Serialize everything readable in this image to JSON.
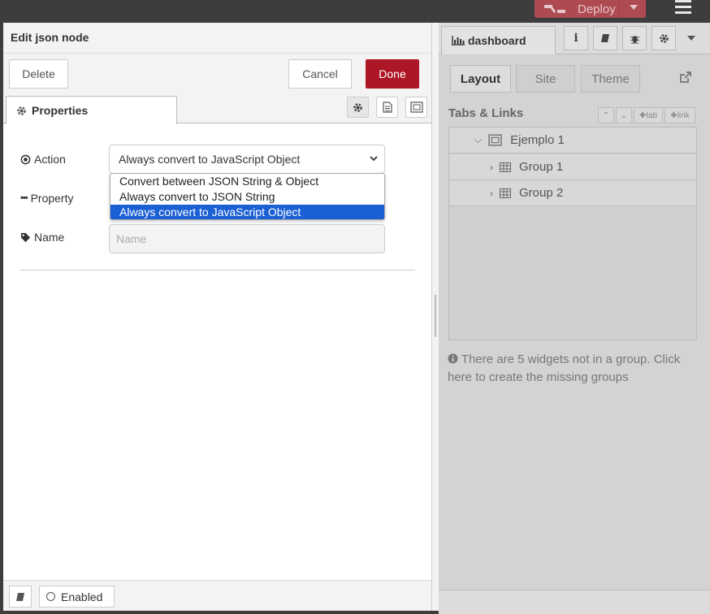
{
  "header": {
    "deploy_label": "Deploy"
  },
  "tray": {
    "title": "Edit json node",
    "buttons": {
      "delete": "Delete",
      "cancel": "Cancel",
      "done": "Done"
    },
    "tab_label": "Properties",
    "form": {
      "action_label": "Action",
      "action_value": "Always convert to JavaScript Object",
      "action_options": [
        "Convert between JSON String & Object",
        "Always convert to JSON String",
        "Always convert to JavaScript Object"
      ],
      "property_label": "Property",
      "name_label": "Name",
      "name_placeholder": "Name"
    },
    "footer": {
      "enabled_label": "Enabled"
    }
  },
  "sidebar": {
    "tab_label": "dashboard",
    "info_glyph": "i",
    "subtabs": [
      "Layout",
      "Site",
      "Theme"
    ],
    "tabs_links_label": "Tabs & Links",
    "tab_buttons": [
      "tab",
      "link"
    ],
    "tree": {
      "tab": "Ejemplo 1",
      "groups": [
        "Group 1",
        "Group 2"
      ]
    },
    "note": "There are 5 widgets not in a group. Click here to create the missing groups"
  },
  "colors": {
    "done": "#ad1625",
    "deploy": "#ad4a52",
    "selected_option": "#1a5fd4"
  }
}
